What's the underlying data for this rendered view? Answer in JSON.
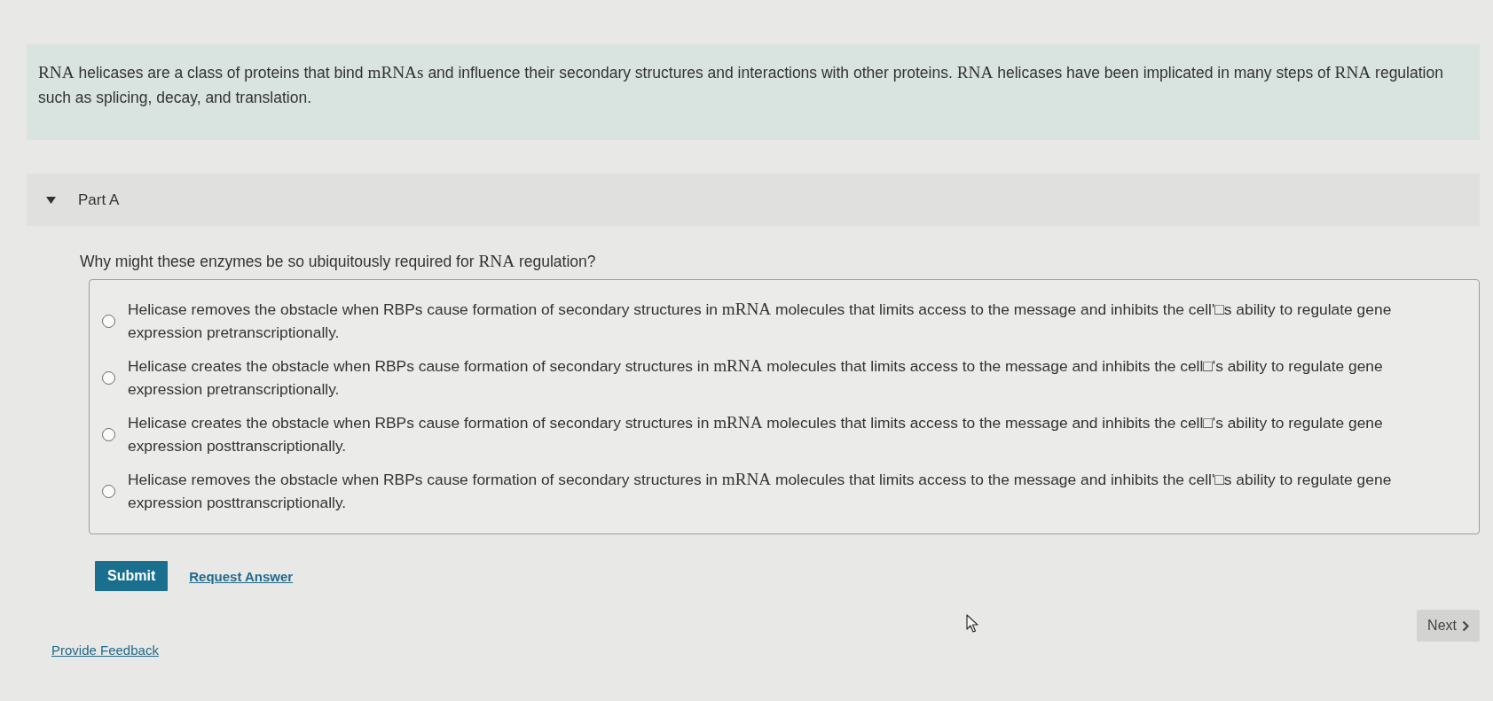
{
  "intro": {
    "segments": [
      {
        "kind": "math",
        "text": "RNA"
      },
      {
        "kind": "text",
        "text": " helicases are a class of proteins that bind "
      },
      {
        "kind": "math",
        "text": "mRNAs"
      },
      {
        "kind": "text",
        "text": " and influence their secondary structures and interactions with other proteins. "
      },
      {
        "kind": "math",
        "text": "RNA"
      },
      {
        "kind": "text",
        "text": " helicases have been implicated in many steps of "
      },
      {
        "kind": "math",
        "text": "RNA"
      },
      {
        "kind": "text",
        "text": " regulation such as splicing, decay, and translation."
      }
    ]
  },
  "part": {
    "label": "Part A",
    "expanded": true,
    "question": {
      "segments": [
        {
          "kind": "text",
          "text": "Why might these enzymes be so ubiquitously required for "
        },
        {
          "kind": "math",
          "text": "RNA"
        },
        {
          "kind": "text",
          "text": " regulation?"
        }
      ]
    },
    "options": [
      {
        "selected": false,
        "segments": [
          {
            "kind": "text",
            "text": "Helicase removes the obstacle when RBPs cause formation of secondary structures in "
          },
          {
            "kind": "math",
            "text": "mRNA"
          },
          {
            "kind": "text",
            "text": " molecules that limits access to the message and inhibits the cell'□s ability to regulate gene expression pretranscriptionally."
          }
        ]
      },
      {
        "selected": false,
        "segments": [
          {
            "kind": "text",
            "text": "Helicase creates the obstacle when RBPs cause formation of secondary structures in "
          },
          {
            "kind": "math",
            "text": "mRNA"
          },
          {
            "kind": "text",
            "text": " molecules that limits access to the message and inhibits the cell□'s ability to regulate gene expression pretranscriptionally."
          }
        ]
      },
      {
        "selected": false,
        "segments": [
          {
            "kind": "text",
            "text": "Helicase creates the obstacle when RBPs cause formation of secondary structures in "
          },
          {
            "kind": "math",
            "text": "mRNA"
          },
          {
            "kind": "text",
            "text": " molecules that limits access to the message and inhibits the cell□'s ability to regulate gene expression posttranscriptionally."
          }
        ]
      },
      {
        "selected": false,
        "segments": [
          {
            "kind": "text",
            "text": "Helicase removes the obstacle when RBPs cause formation of secondary structures in "
          },
          {
            "kind": "math",
            "text": "mRNA"
          },
          {
            "kind": "text",
            "text": " molecules that limits access to the message and inhibits the cell'□s ability to regulate gene expression posttranscriptionally."
          }
        ]
      }
    ],
    "submit_button": "Submit",
    "request_answer_link": "Request Answer"
  },
  "footer": {
    "feedback_link": "Provide Feedback",
    "next_button": "Next"
  }
}
